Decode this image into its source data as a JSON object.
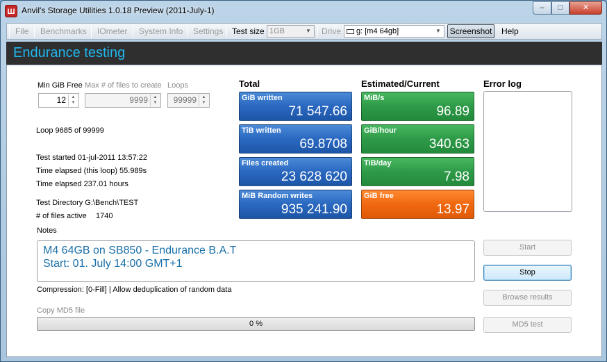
{
  "window": {
    "title": "Anvil's Storage Utilities 1.0.18 Preview (2011-July-1)",
    "app_icon_glyph": "Ш",
    "controls": {
      "minimize": "–",
      "maximize": "□",
      "close": "✕"
    }
  },
  "menubar": {
    "items": [
      "File",
      "Benchmarks",
      "IOmeter",
      "System Info",
      "Settings"
    ],
    "test_size_label": "Test size",
    "test_size_value": "1GB",
    "drive_label": "Drive",
    "drive_value": "g: [m4 64gb]",
    "screenshot_label": "Screenshot",
    "help_label": "Help"
  },
  "header": {
    "title": "Endurance testing"
  },
  "params": {
    "min_gib_free_label": "Min GiB Free",
    "min_gib_free_value": "12",
    "max_files_label": "Max # of files to create",
    "max_files_value": "9999",
    "loops_label": "Loops",
    "loops_value": "99999"
  },
  "status": {
    "loop": "Loop 9685 of 99999",
    "test_started": "Test started 01-jul-2011 13:57:22",
    "time_loop": "Time elapsed (this loop) 55.989s",
    "time_total": "Time elapsed 237.01 hours",
    "test_dir": "Test Directory G:\\Bench\\TEST",
    "files_active_label": "# of files active",
    "files_active_value": "1740"
  },
  "total": {
    "heading": "Total",
    "tiles": [
      {
        "label": "GiB written",
        "value": "71 547.66"
      },
      {
        "label": "TiB written",
        "value": "69.8708"
      },
      {
        "label": "Files created",
        "value": "23 628 620"
      },
      {
        "label": "MiB Random writes",
        "value": "935 241.90"
      }
    ]
  },
  "estimated": {
    "heading": "Estimated/Current",
    "tiles": [
      {
        "label": "MiB/s",
        "value": "96.89"
      },
      {
        "label": "GiB/hour",
        "value": "340.63"
      },
      {
        "label": "TiB/day",
        "value": "7.98"
      },
      {
        "label": "GiB free",
        "value": "13.97"
      }
    ]
  },
  "error_log": {
    "heading": "Error log"
  },
  "notes": {
    "label": "Notes",
    "line1": "M4 64GB on SB850 - Endurance B.A.T",
    "line2": "Start: 01. July 14:00 GMT+1"
  },
  "compression": {
    "text": "Compression: [0-Fill] | Allow deduplication of random data"
  },
  "md5": {
    "label": "Copy MD5 file",
    "progress_text": "0 %",
    "progress_fraction": 0
  },
  "buttons": {
    "start": "Start",
    "stop": "Stop",
    "browse": "Browse results",
    "md5test": "MD5 test"
  },
  "colors": {
    "header_text": "#21b7f0",
    "tile_blue": "#2a68c0",
    "tile_green": "#2e9a48",
    "tile_orange": "#f06810",
    "notes_text": "#1a6fa8"
  }
}
